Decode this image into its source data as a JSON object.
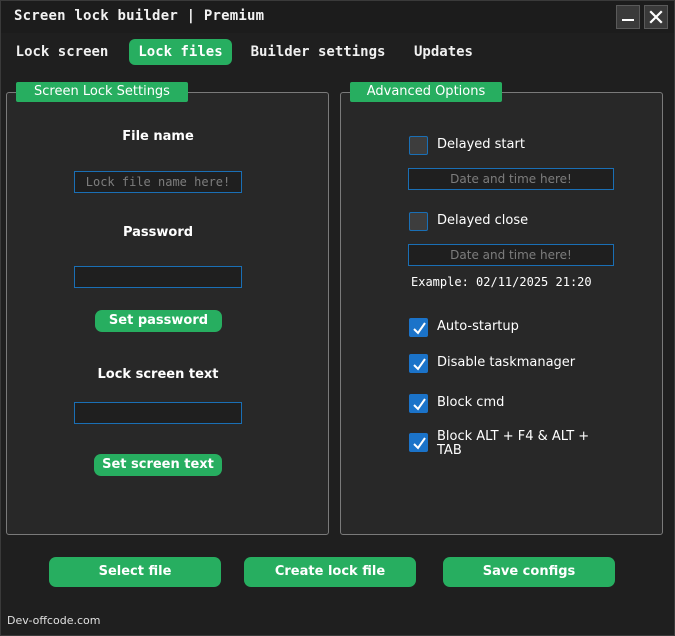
{
  "window": {
    "title": "Screen lock builder | Premium",
    "minimize_icon": "minimize-icon",
    "close_icon": "close-icon"
  },
  "tabs": [
    {
      "label": "Lock screen",
      "active": false
    },
    {
      "label": "Lock files",
      "active": true
    },
    {
      "label": "Builder settings",
      "active": false
    },
    {
      "label": "Updates",
      "active": false
    }
  ],
  "left_panel": {
    "title": "Screen Lock Settings",
    "file_name_label": "File name",
    "file_name_value": "",
    "file_name_placeholder": "Lock file name here!",
    "password_label": "Password",
    "password_value": "",
    "set_password_label": "Set password",
    "lock_text_label": "Lock screen text",
    "lock_text_value": "",
    "set_screen_text_label": "Set screen text"
  },
  "right_panel": {
    "title": "Advanced Options",
    "delayed_start": {
      "label": "Delayed start",
      "checked": false
    },
    "delayed_start_placeholder": "Date and time here!",
    "delayed_close": {
      "label": "Delayed close",
      "checked": false
    },
    "delayed_close_placeholder": "Date and time here!",
    "example_text": "Example: 02/11/2025 21:20",
    "auto_startup": {
      "label": "Auto-startup",
      "checked": true
    },
    "disable_taskmanager": {
      "label": "Disable taskmanager",
      "checked": true
    },
    "block_cmd": {
      "label": "Block cmd",
      "checked": true
    },
    "block_alt": {
      "label_line1": "Block ALT + F4  &  ALT +",
      "label_line2": "TAB",
      "checked": true
    }
  },
  "bottom_buttons": {
    "select_file": "Select file",
    "create_lock_file": "Create lock file",
    "save_configs": "Save configs"
  },
  "footer": {
    "text": "Dev-offcode.com"
  },
  "colors": {
    "accent": "#27ae60",
    "input_border": "#1a6fb5",
    "checkbox_checked": "#1b73c9",
    "background": "#1f1f1f"
  }
}
